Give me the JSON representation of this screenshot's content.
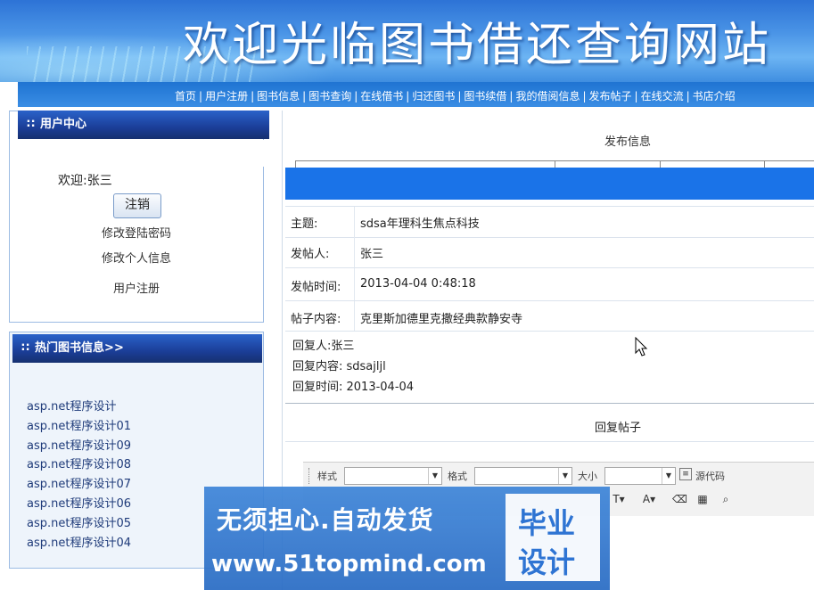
{
  "banner": {
    "title": "欢迎光临图书借还查询网站"
  },
  "nav": {
    "items": [
      "首页",
      "用户注册",
      "图书信息",
      "图书查询",
      "在线借书",
      "归还图书",
      "图书续借",
      "我的借阅信息",
      "发布帖子",
      "在线交流",
      "书店介绍"
    ],
    "separator": "|"
  },
  "user_center": {
    "title": "用户中心",
    "welcome": "欢迎:张三",
    "logout_label": "注销",
    "links": [
      "修改登陆密码",
      "修改个人信息",
      "用户注册"
    ]
  },
  "hot_books": {
    "title": "热门图书信息>>",
    "items": [
      "asp.net程序设计",
      "asp.net程序设计01",
      "asp.net程序设计09",
      "asp.net程序设计08",
      "asp.net程序设计07",
      "asp.net程序设计06",
      "asp.net程序设计05",
      "asp.net程序设计04"
    ]
  },
  "post": {
    "header": "发布信息",
    "fields": [
      {
        "label": "主题:",
        "value": "sdsa年理科生焦点科技"
      },
      {
        "label": "发帖人:",
        "value": "张三"
      },
      {
        "label": "发帖时间:",
        "value": "2013-04-04 0:48:18"
      },
      {
        "label": "帖子内容:",
        "value": "克里斯加德里克撒经典款静安寺"
      }
    ]
  },
  "reply": {
    "lines": [
      "回复人:张三",
      "回复内容: sdsajljl",
      "回复时间: 2013-04-04"
    ],
    "title": "回复帖子"
  },
  "editor": {
    "style_label": "样式",
    "format_label": "格式",
    "size_label": "大小",
    "source_label": "源代码"
  },
  "overlay": {
    "line1": "无须担心.自动发货",
    "line2": "www.51topmind.com",
    "badge_line1": "毕业",
    "badge_line2": "设计"
  }
}
